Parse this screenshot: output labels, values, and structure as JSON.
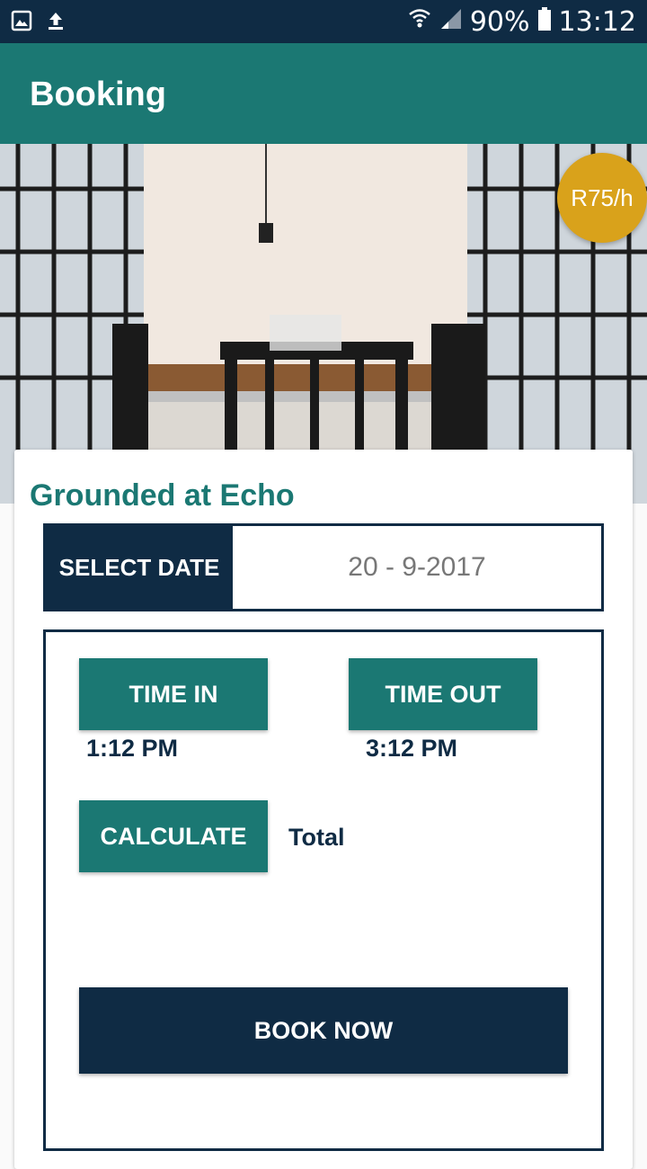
{
  "status_bar": {
    "battery": "90%",
    "time": "13:12",
    "icons": [
      "image-icon",
      "upload-icon",
      "wifi-icon",
      "signal-icon",
      "battery-icon"
    ]
  },
  "app_bar": {
    "title": "Booking"
  },
  "listing": {
    "price": "R75/h",
    "venue_name": "Grounded at Echo"
  },
  "booking": {
    "select_date_label": "SELECT DATE",
    "date_value": "20 - 9-2017",
    "time_in_label": "TIME IN",
    "time_in_value": "1:12 PM",
    "time_out_label": "TIME OUT",
    "time_out_value": "3:12 PM",
    "calculate_label": "CALCULATE",
    "total_label": "Total",
    "book_now_label": "BOOK NOW"
  },
  "colors": {
    "primary_dark": "#0f2b44",
    "primary": "#1b7873",
    "accent": "#d9a21b"
  }
}
